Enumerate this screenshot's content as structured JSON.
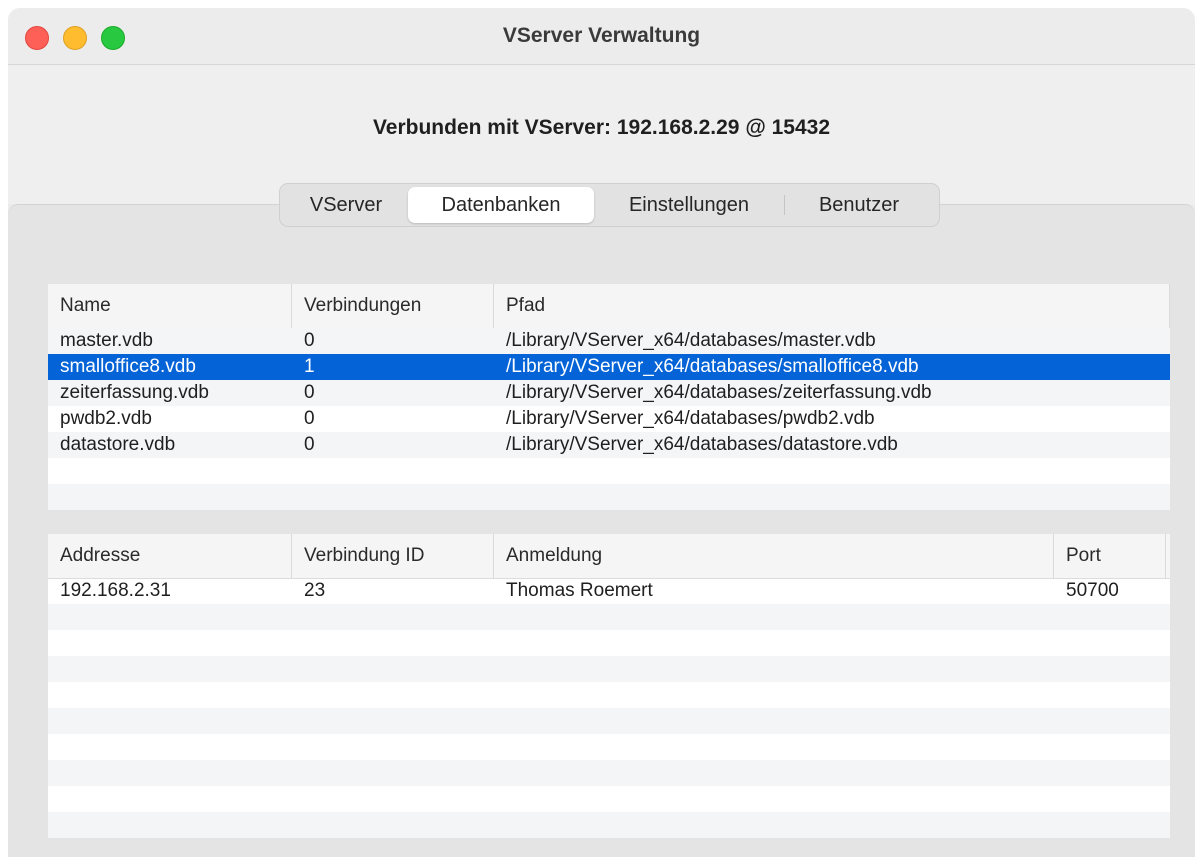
{
  "window": {
    "title": "VServer Verwaltung"
  },
  "connection_title": "Verbunden mit VServer: 192.168.2.29 @ 15432",
  "tabs": [
    {
      "label": "VServer",
      "selected": false
    },
    {
      "label": "Datenbanken",
      "selected": true
    },
    {
      "label": "Einstellungen",
      "selected": false
    },
    {
      "label": "Benutzer",
      "selected": false
    }
  ],
  "databases": {
    "columns": [
      "Name",
      "Verbindungen",
      "Pfad"
    ],
    "rows": [
      {
        "name": "master.vdb",
        "connections": "0",
        "path": "/Library/VServer_x64/databases/master.vdb"
      },
      {
        "name": "smalloffice8.vdb",
        "connections": "1",
        "path": "/Library/VServer_x64/databases/smalloffice8.vdb"
      },
      {
        "name": "zeiterfassung.vdb",
        "connections": "0",
        "path": "/Library/VServer_x64/databases/zeiterfassung.vdb"
      },
      {
        "name": "pwdb2.vdb",
        "connections": "0",
        "path": "/Library/VServer_x64/databases/pwdb2.vdb"
      },
      {
        "name": "datastore.vdb",
        "connections": "0",
        "path": "/Library/VServer_x64/databases/datastore.vdb"
      }
    ],
    "selected_row": 1
  },
  "sessions": {
    "columns": [
      "Addresse",
      "Verbindung ID",
      "Anmeldung",
      "Port"
    ],
    "rows": [
      {
        "address": "192.168.2.31",
        "id": "23",
        "login": "Thomas Roemert",
        "port": "50700"
      }
    ]
  },
  "colors": {
    "selection": "#0463d6",
    "close": "#fe5f57",
    "minimize": "#febc2e",
    "maximize": "#28c840"
  }
}
